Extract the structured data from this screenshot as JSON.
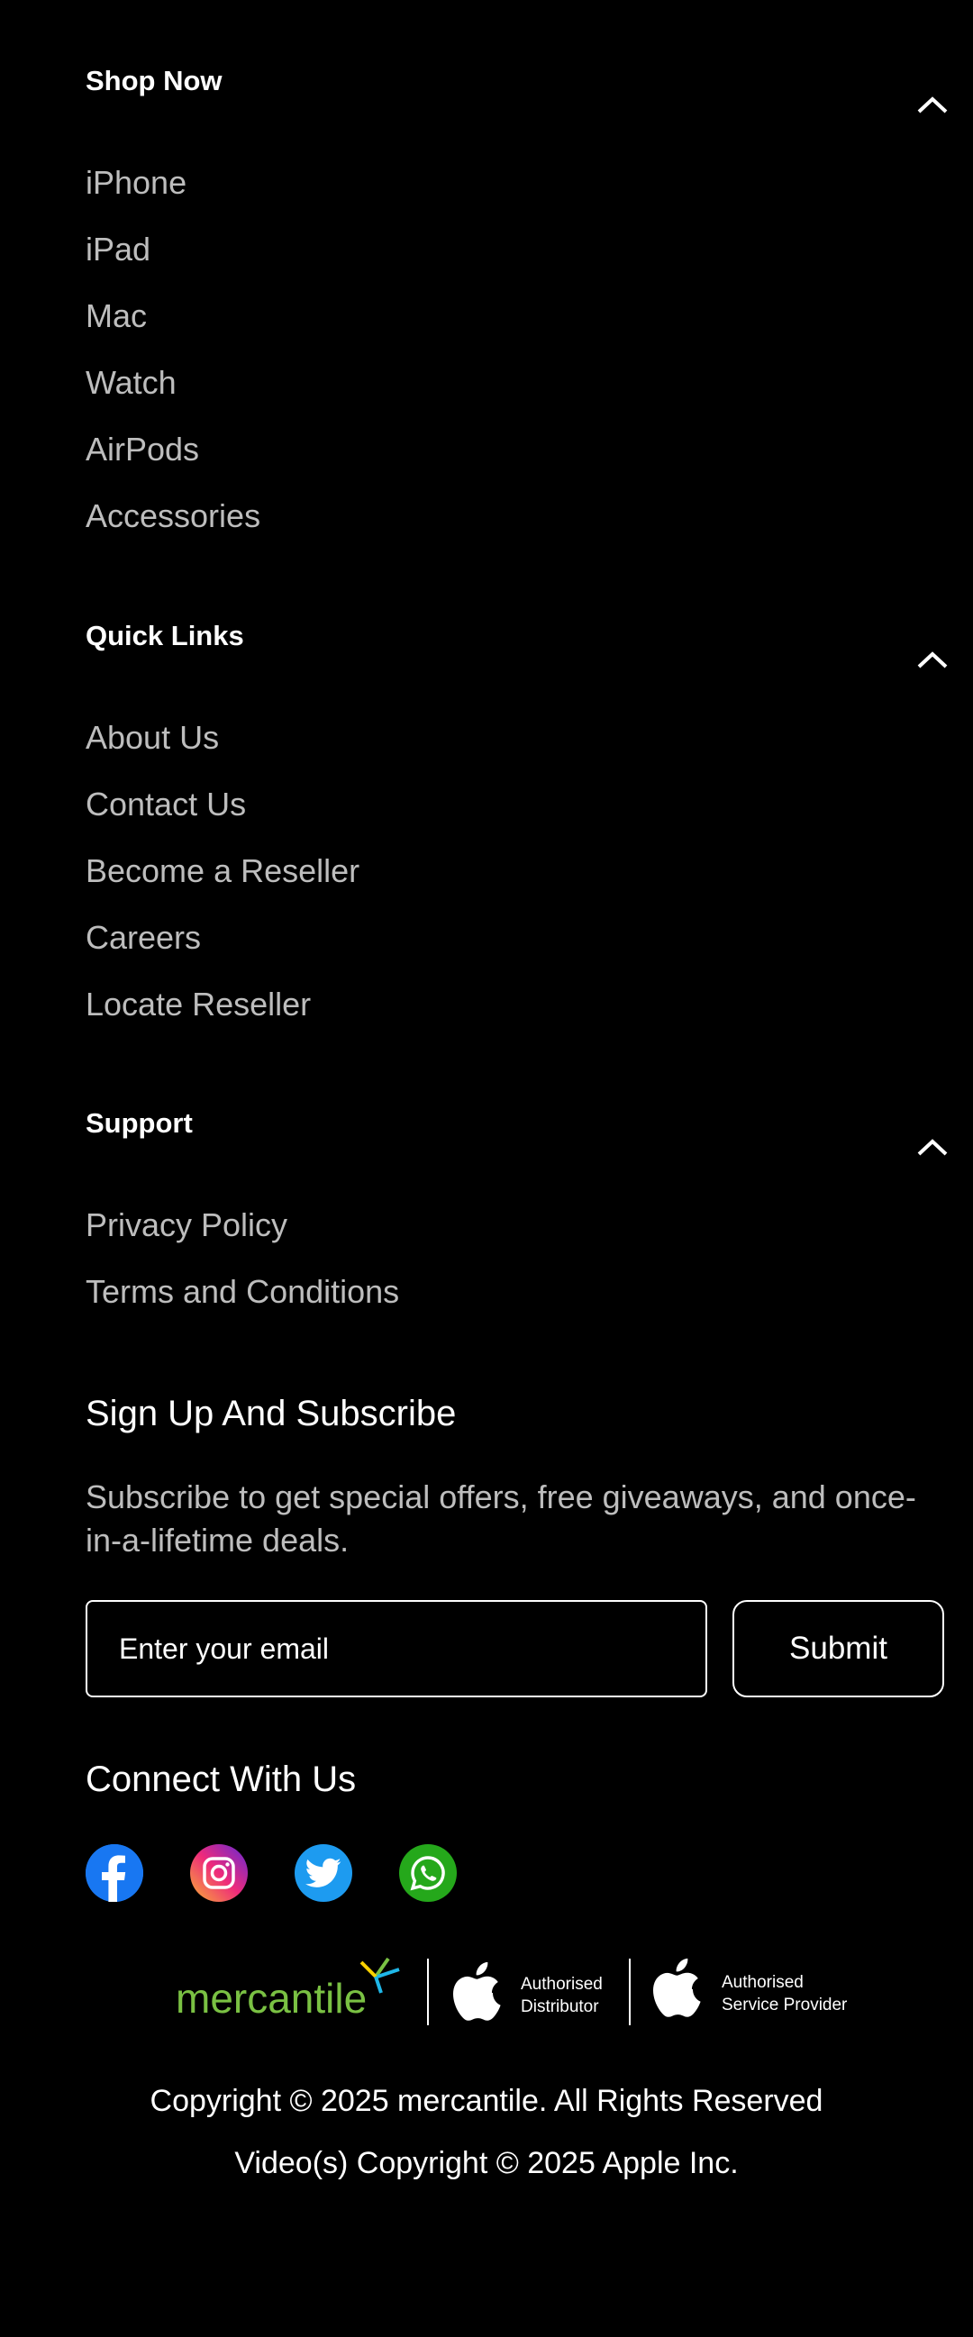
{
  "sections": {
    "shop_now": {
      "title": "Shop Now",
      "links": [
        "iPhone",
        "iPad",
        "Mac",
        "Watch",
        "AirPods",
        "Accessories"
      ]
    },
    "quick_links": {
      "title": "Quick Links",
      "links": [
        "About Us",
        "Contact Us",
        "Become a Reseller",
        "Careers",
        "Locate Reseller"
      ]
    },
    "support": {
      "title": "Support",
      "links": [
        "Privacy Policy",
        "Terms and Conditions"
      ]
    }
  },
  "subscribe": {
    "heading": "Sign Up And Subscribe",
    "description": "Subscribe to get special offers, free giveaways, and once-in-a-lifetime deals.",
    "email_placeholder": "Enter your email",
    "submit_label": "Submit"
  },
  "connect": {
    "heading": "Connect With Us",
    "icons": [
      "facebook-icon",
      "instagram-icon",
      "twitter-icon",
      "whatsapp-icon"
    ]
  },
  "badges": {
    "brand_logo": "mercantile",
    "distributor_line1": "Authorised",
    "distributor_line2": "Distributor",
    "service_line1": "Authorised",
    "service_line2": "Service Provider"
  },
  "copyright": {
    "line1": "Copyright © 2025 mercantile. All Rights Reserved",
    "line2": "Video(s) Copyright © 2025 Apple Inc."
  },
  "colors": {
    "background": "#000000",
    "link": "#bdbdbd",
    "facebook": "#1877f2",
    "twitter": "#1d9bf0",
    "whatsapp": "#25a81b",
    "mercantile_green": "#7ac143"
  }
}
